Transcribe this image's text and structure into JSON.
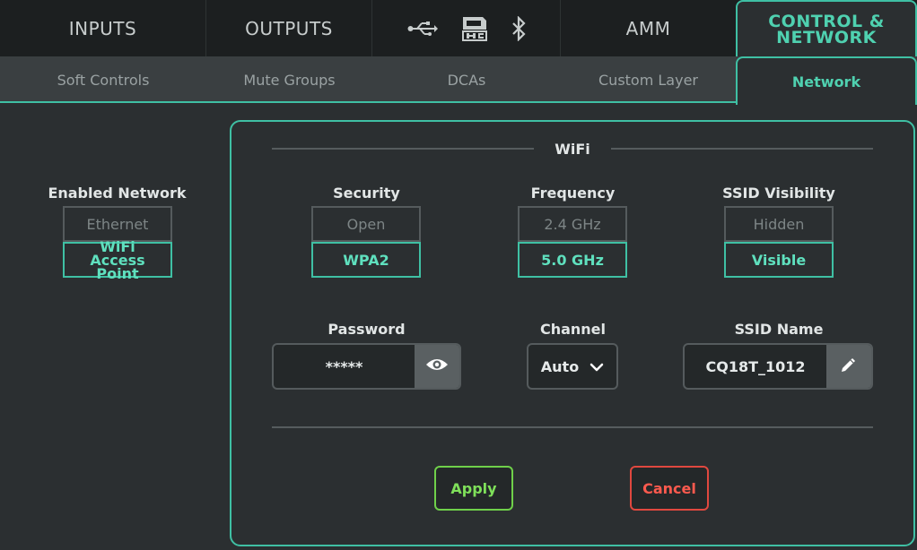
{
  "top_tabs": {
    "inputs": "INPUTS",
    "outputs": "OUTPUTS",
    "icons": [
      "usb-icon",
      "sd-card-icon",
      "bluetooth-icon"
    ],
    "amm": "AMM",
    "control_line1": "CONTROL &",
    "control_line2": "NETWORK"
  },
  "sub_tabs": {
    "soft_controls": "Soft Controls",
    "mute_groups": "Mute Groups",
    "dcas": "DCAs",
    "custom_layer": "Custom Layer",
    "network": "Network"
  },
  "enabled_network": {
    "label": "Enabled Network",
    "options": [
      "Ethernet",
      "WiFi Access Point"
    ],
    "selected": "WiFi Access Point"
  },
  "wifi": {
    "title": "WiFi",
    "security": {
      "label": "Security",
      "options": [
        "Open",
        "WPA2"
      ],
      "selected": "WPA2"
    },
    "frequency": {
      "label": "Frequency",
      "options": [
        "2.4 GHz",
        "5.0 GHz"
      ],
      "selected": "5.0 GHz"
    },
    "ssid_visibility": {
      "label": "SSID Visibility",
      "options": [
        "Hidden",
        "Visible"
      ],
      "selected": "Visible"
    },
    "password": {
      "label": "Password",
      "value": "*****"
    },
    "channel": {
      "label": "Channel",
      "value": "Auto"
    },
    "ssid_name": {
      "label": "SSID Name",
      "value": "CQ18T_1012"
    }
  },
  "actions": {
    "apply": "Apply",
    "cancel": "Cancel"
  },
  "colors": {
    "accent": "#3fc0a4",
    "apply": "#7fe05a",
    "cancel": "#ff5a4e"
  }
}
